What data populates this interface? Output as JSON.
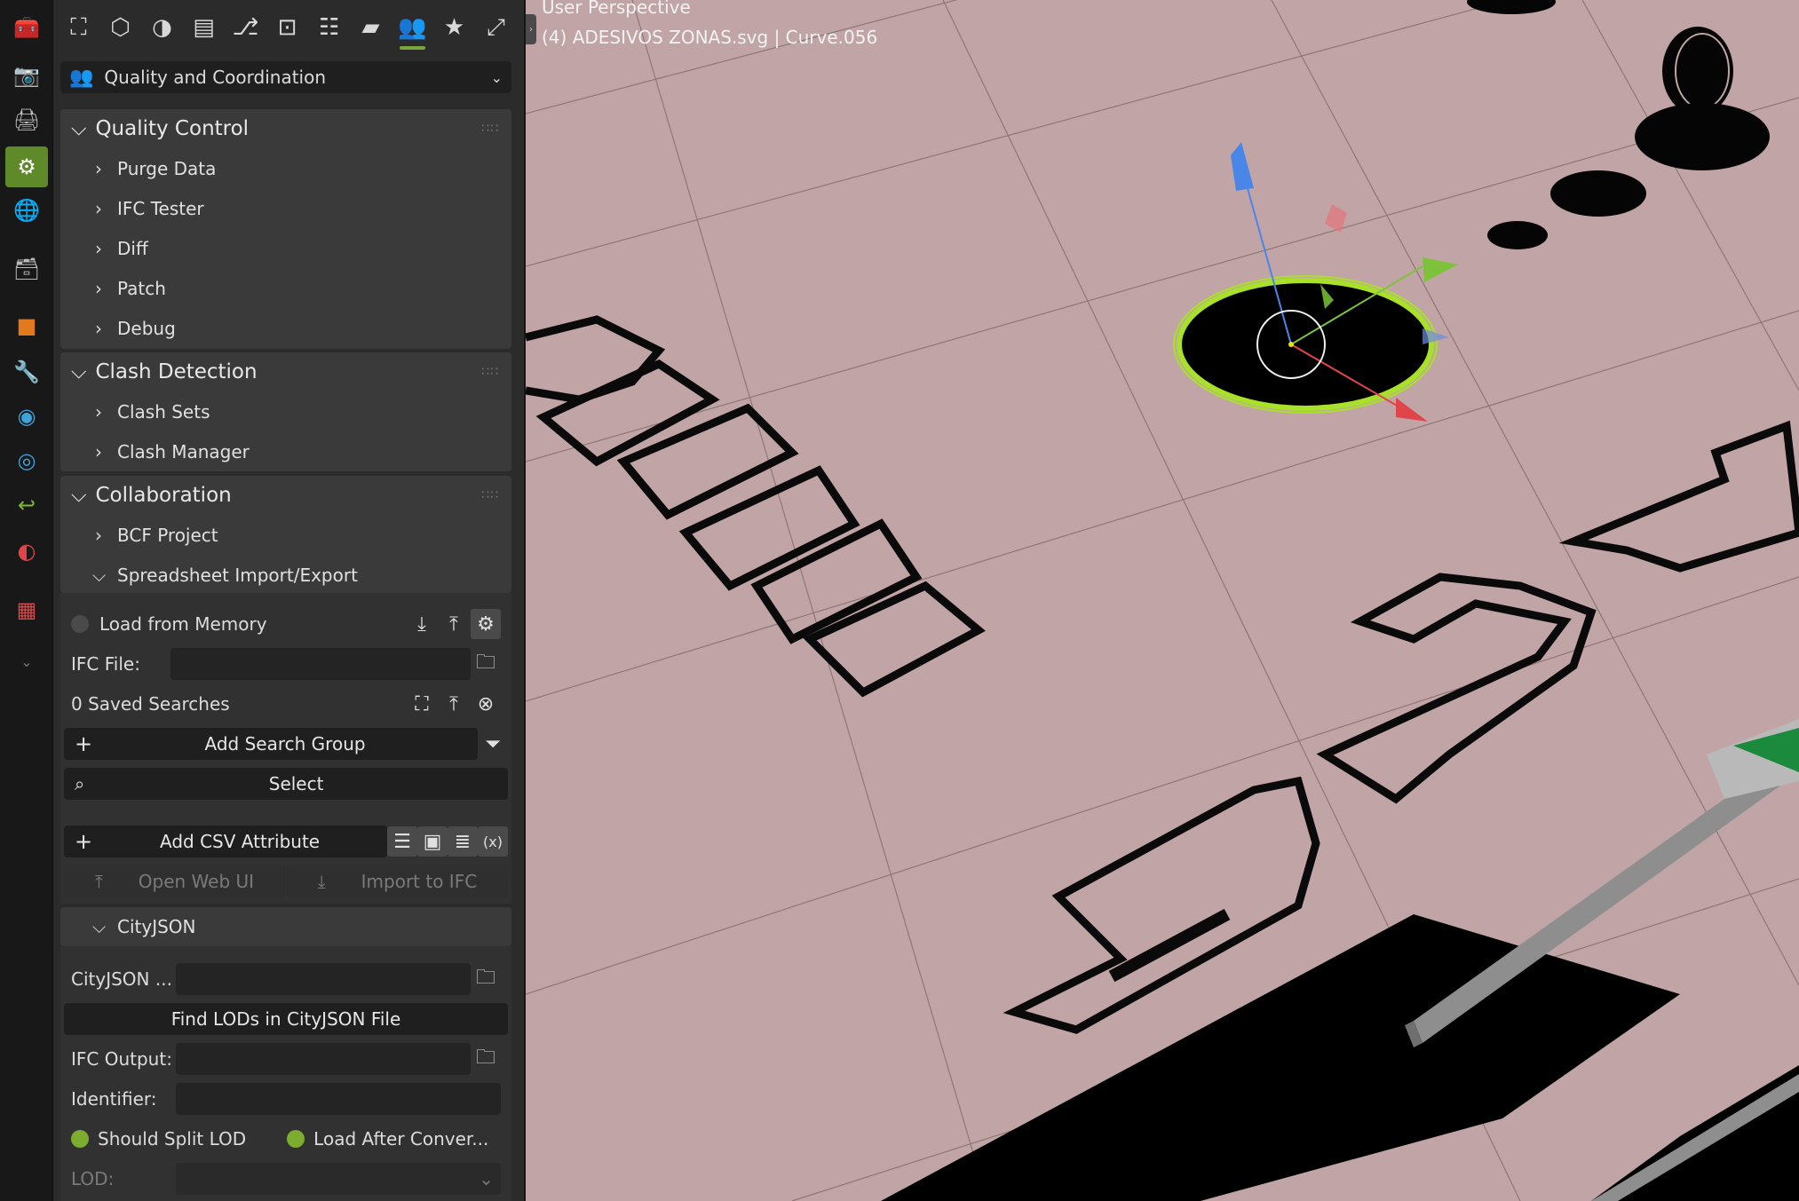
{
  "tabs": [
    "tool",
    "render",
    "output",
    "scene",
    "world",
    "collection",
    "object",
    "modifiers",
    "particles",
    "physics",
    "constraints",
    "data",
    "material",
    "texture",
    "more"
  ],
  "toolbar_icons": [
    "project-icon",
    "geometry-icon",
    "shading-icon",
    "drawings-icon",
    "services-icon",
    "structural-icon",
    "scheduling-icon",
    "facility-icon",
    "quality-icon",
    "favorites-icon",
    "migration-icon"
  ],
  "context": {
    "label": "Quality and Coordination"
  },
  "quality_control": {
    "title": "Quality Control",
    "items": [
      "Purge Data",
      "IFC Tester",
      "Diff",
      "Patch",
      "Debug"
    ]
  },
  "clash_detection": {
    "title": "Clash Detection",
    "items": [
      "Clash Sets",
      "Clash Manager"
    ]
  },
  "collaboration": {
    "title": "Collaboration",
    "bcf": "BCF Project",
    "spreadsheet": "Spreadsheet Import/Export",
    "load_from_memory": "Load from Memory",
    "ifc_file_label": "IFC File:",
    "saved_searches": "0 Saved Searches",
    "add_search_group": "Add Search Group",
    "select": "Select",
    "add_csv_attribute": "Add CSV Attribute",
    "open_web_ui": "Open Web UI",
    "import_to_ifc": "Import to IFC"
  },
  "cityjson": {
    "title": "CityJSON",
    "file_label": "CityJSON ...",
    "find_lods": "Find LODs in CityJSON File",
    "ifc_output_label": "IFC Output:",
    "identifier_label": "Identifier:",
    "should_split_lod": "Should Split LOD",
    "load_after_convert": "Load After Conver...",
    "lod_label": "LOD:"
  },
  "viewport": {
    "title": "User Perspective",
    "subtitle": "(4) ADESIVOS ZONAS.svg | Curve.056",
    "floor_color": "#c1a5a6",
    "selection_color": "#a8e02a"
  }
}
